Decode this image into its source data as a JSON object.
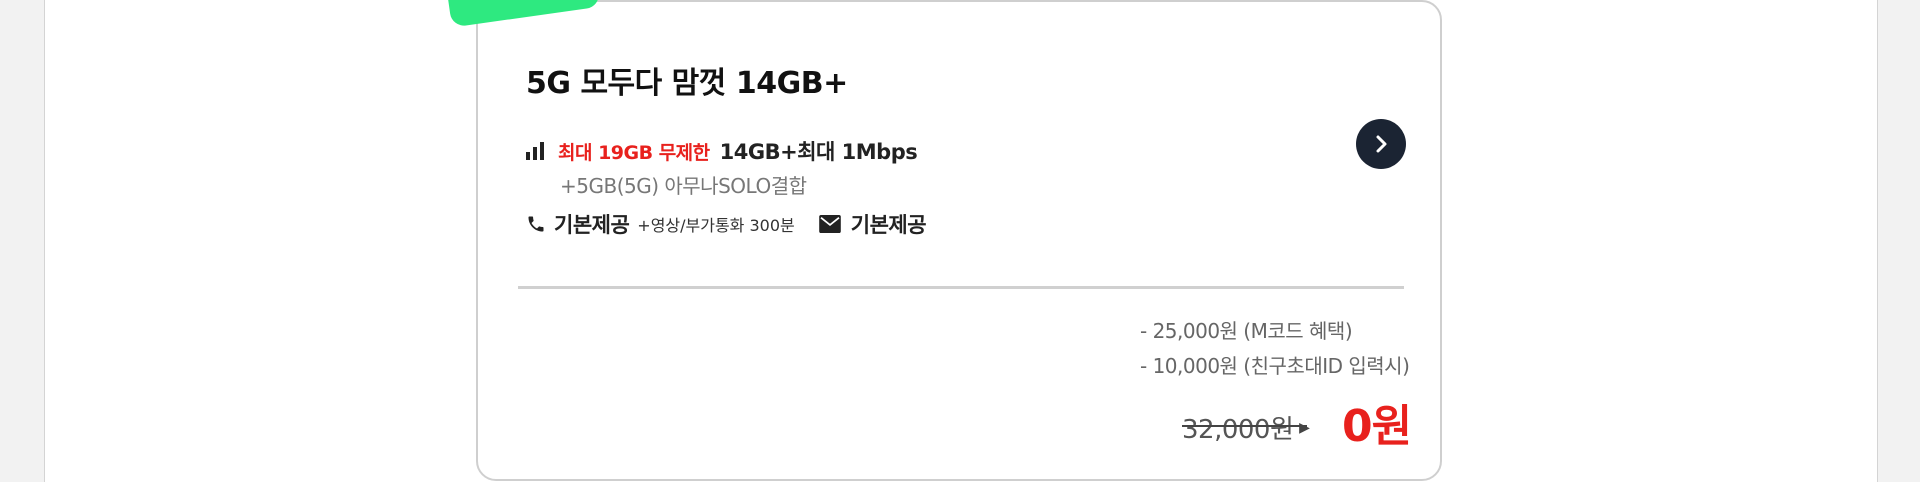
{
  "plan": {
    "title": "5G 모두다 맘껏 14GB+",
    "data_highlight": "최대 19GB 무제한",
    "data_main": "14GB+최대 1Mbps",
    "data_sub": "+5GB(5G) 아무나SOLO결합",
    "call_label": "기본제공",
    "call_extra": "+영상/부가통화 300분",
    "sms_label": "기본제공"
  },
  "pricing": {
    "discounts": [
      "- 25,000원 (M코드 혜택)",
      "- 10,000원 (친구초대ID 입력시)"
    ],
    "original_price": "32,000원",
    "final_price": "0원"
  },
  "colors": {
    "accent_green": "#2ee980",
    "price_red": "#e8211d",
    "button_dark": "#1b2433"
  },
  "icons": {
    "data": "signal-bars-icon",
    "call": "phone-icon",
    "sms": "mail-icon",
    "next": "chevron-right-icon"
  }
}
